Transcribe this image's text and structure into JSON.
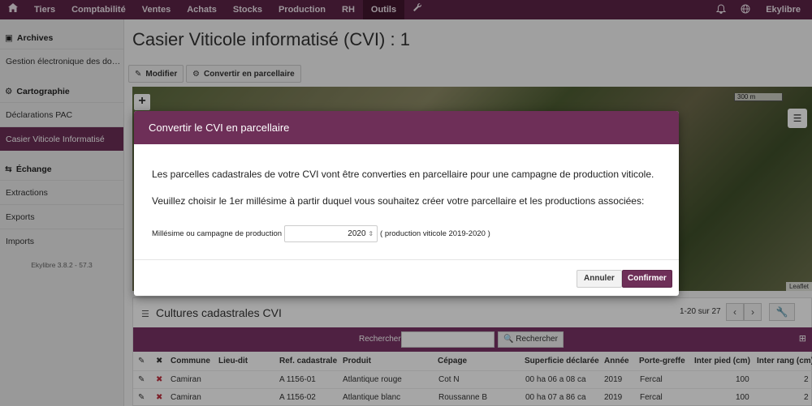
{
  "topbar": {
    "items": [
      "Tiers",
      "Comptabilité",
      "Ventes",
      "Achats",
      "Stocks",
      "Production",
      "RH",
      "Outils"
    ],
    "active": "Outils",
    "user": "Ekylibre"
  },
  "sidebar": {
    "archives_title": "Archives",
    "archives_item": "Gestion électronique des documents",
    "carto_title": "Cartographie",
    "carto_items": [
      "Déclarations PAC",
      "Casier Viticole Informatisé"
    ],
    "echange_title": "Échange",
    "echange_items": [
      "Extractions",
      "Exports",
      "Imports"
    ],
    "version": "Ekylibre 3.8.2 - 57.3"
  },
  "page": {
    "title": "Casier Viticole informatisé (CVI)  : 1",
    "modify_label": "Modifier",
    "convert_label": "Convertir en parcellaire"
  },
  "map": {
    "scale": "300 m",
    "attribution": "Leaflet"
  },
  "panel": {
    "title": "Cultures cadastrales CVI",
    "pager": "1-20 sur 27",
    "search_label": "Rechercher",
    "search_button": "Rechercher",
    "columns": [
      "Commune",
      "Lieu-dit",
      "Ref. cadastrale",
      "Produit",
      "Cépage",
      "Superficie déclarée",
      "Année",
      "Porte-greffe",
      "Inter pied (cm)",
      "Inter rang (cm)"
    ],
    "rows": [
      {
        "commune": "Camiran",
        "lieu": "",
        "ref": "A 1156-01",
        "produit": "Atlantique rouge",
        "cepage": "Cot N",
        "superficie": "00 ha 06 a 08 ca",
        "annee": "2019",
        "porte": "Fercal",
        "pied": "100",
        "rang": "2"
      },
      {
        "commune": "Camiran",
        "lieu": "",
        "ref": "A 1156-02",
        "produit": "Atlantique blanc",
        "cepage": "Roussanne B",
        "superficie": "00 ha 07 a 86 ca",
        "annee": "2019",
        "porte": "Fercal",
        "pied": "100",
        "rang": "2"
      }
    ]
  },
  "modal": {
    "title": "Convertir le CVI en parcellaire",
    "text1": "Les parcelles cadastrales de votre CVI vont être converties en parcellaire pour une campagne de production viticole.",
    "text2": "Veuillez choisir le 1er millésime à partir duquel vous souhaitez créer votre parcellaire et les productions associées:",
    "field_label": "Millésime ou campagne de production",
    "field_value": "2020",
    "field_hint": "( production viticole 2019-2020 )",
    "cancel": "Annuler",
    "confirm": "Confirmer"
  }
}
